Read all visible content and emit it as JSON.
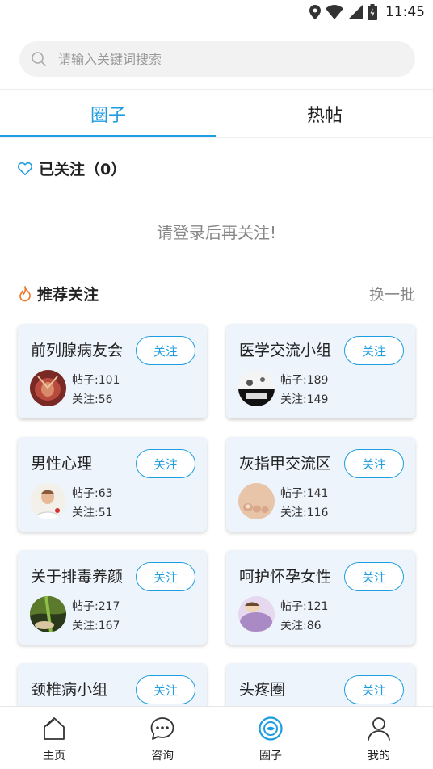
{
  "status_bar": {
    "time": "11:45"
  },
  "search": {
    "placeholder": "请输入关键词搜索"
  },
  "tabs": [
    {
      "label": "圈子",
      "active": true
    },
    {
      "label": "热帖",
      "active": false
    }
  ],
  "followed": {
    "title": "已关注（0）",
    "hint": "请登录后再关注!"
  },
  "recommend": {
    "title": "推荐关注",
    "refresh_label": "换一批",
    "groups": [
      {
        "name": "前列腺病友会",
        "posts": "帖子:101",
        "follows": "关注:56",
        "button": "关注"
      },
      {
        "name": "医学交流小组",
        "posts": "帖子:189",
        "follows": "关注:149",
        "button": "关注"
      },
      {
        "name": "男性心理",
        "posts": "帖子:63",
        "follows": "关注:51",
        "button": "关注"
      },
      {
        "name": "灰指甲交流区",
        "posts": "帖子:141",
        "follows": "关注:116",
        "button": "关注"
      },
      {
        "name": "关于排毒养颜",
        "posts": "帖子:217",
        "follows": "关注:167",
        "button": "关注"
      },
      {
        "name": "呵护怀孕女性",
        "posts": "帖子:121",
        "follows": "关注:86",
        "button": "关注"
      },
      {
        "name": "颈椎病小组",
        "button": "关注"
      },
      {
        "name": "头疼圈",
        "button": "关注"
      }
    ]
  },
  "bottom_nav": [
    {
      "label": "主页",
      "icon": "home-icon"
    },
    {
      "label": "咨询",
      "icon": "chat-icon"
    },
    {
      "label": "圈子",
      "icon": "circle-icon",
      "active": true
    },
    {
      "label": "我的",
      "icon": "profile-icon"
    }
  ],
  "colors": {
    "accent": "#1e9de0",
    "fire": "#f07a2e",
    "card_bg": "#eef4fc"
  }
}
